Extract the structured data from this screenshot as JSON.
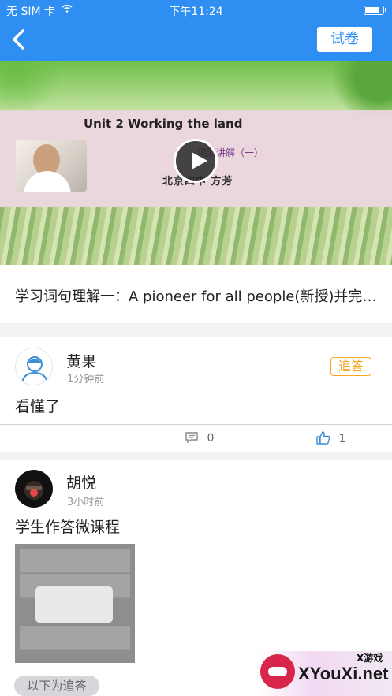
{
  "status_bar": {
    "carrier": "无 SIM 卡",
    "time": "下午11:24",
    "battery_level": 0.85
  },
  "nav": {
    "quiz_label": "试卷"
  },
  "video": {
    "title": "Unit 2 Working the land",
    "subtitle": "词汇讲解（一）",
    "author": "北京四中 方芳"
  },
  "course": {
    "title": "学习词句理解一：A pioneer for all people(新授)并完成..."
  },
  "comments": [
    {
      "name": "黄果",
      "time": "1分钟前",
      "content": "看懂了",
      "reply_label": "追答",
      "comment_count": "0",
      "like_count": "1"
    },
    {
      "name": "胡悦",
      "time": "3小时前",
      "content": "学生作答微课程"
    }
  ],
  "follow_up_label": "以下为追答",
  "watermark": {
    "site": "XYouXi.net",
    "small": "X游戏"
  }
}
